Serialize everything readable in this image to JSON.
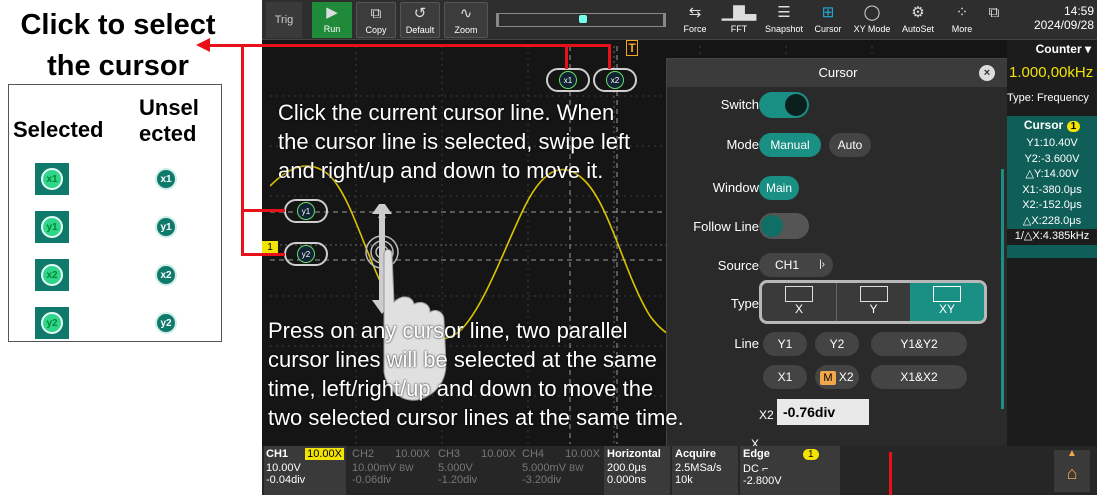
{
  "annotation": {
    "click_select_line1": "Click to select",
    "click_select_line2": "the cursor",
    "legend_selected": "Selected",
    "legend_unselected_1": "Unsel",
    "legend_unselected_2": "ected",
    "icons": [
      "x1",
      "y1",
      "x2",
      "y2"
    ],
    "hint_top": [
      "Click the current cursor line. When",
      "the cursor line is selected, swipe left",
      "and right/up and down to move it."
    ],
    "hint_bottom": [
      "Press on any cursor line, two parallel",
      "cursor lines will be selected at the same",
      "time, left/right/up and down to move the",
      "two selected cursor lines at the same time."
    ]
  },
  "toolbar": {
    "trig": "Trig",
    "buttons": [
      {
        "label": "Run",
        "icon": "play-icon"
      },
      {
        "label": "Copy",
        "icon": "copy-icon"
      },
      {
        "label": "Default",
        "icon": "reset-icon"
      },
      {
        "label": "Zoom",
        "icon": "zoom-wave-icon"
      },
      {
        "label": "Force",
        "icon": "force-trigger-icon"
      },
      {
        "label": "FFT",
        "icon": "fft-icon"
      },
      {
        "label": "Snapshot",
        "icon": "snapshot-icon"
      },
      {
        "label": "Cursor",
        "icon": "cursor-grid-icon"
      },
      {
        "label": "XY Mode",
        "icon": "xy-mode-icon"
      },
      {
        "label": "AutoSet",
        "icon": "autoset-icon"
      },
      {
        "label": "More",
        "icon": "more-grid-icon"
      }
    ],
    "time": "14:59",
    "date": "2024/09/28"
  },
  "waveform_tags": {
    "x1": "x1",
    "x2": "x2",
    "y1": "y1",
    "y2": "y2",
    "trigger_marker": "T",
    "ch_marker": "1"
  },
  "cursor_dialog": {
    "title": "Cursor",
    "switch_label": "Switch",
    "switch_on": true,
    "mode_label": "Mode",
    "mode_options": [
      "Manual",
      "Auto"
    ],
    "mode_selected": "Manual",
    "window_label": "Window",
    "window_value": "Main",
    "follow_label": "Follow Line",
    "follow_on": false,
    "source_label": "Source",
    "source_value": "CH1",
    "type_label": "Type",
    "type_options": [
      "X",
      "Y",
      "XY"
    ],
    "type_selected": "XY",
    "line_label": "Line",
    "line_row1": [
      "Y1",
      "Y2",
      "Y1&Y2"
    ],
    "line_row2_prefix": "M",
    "line_row2": [
      "X1",
      "X2",
      "X1&X2"
    ],
    "line_selected": "X2",
    "value_label": "X2",
    "value": "-0.76div",
    "next_row_partial": "X Unit"
  },
  "counter_panel": {
    "header": "Counter",
    "freq": "1.000,00kHz",
    "type": "Type: Frequency",
    "cursor_title": "Cursor",
    "cursor_badge": "1",
    "readings": [
      "Y1:10.40V",
      "Y2:-3.600V",
      "△Y:14.00V",
      "X1:-380.0μs",
      "X2:-152.0μs",
      "△X:228.0μs",
      "1/△X:4.385kHz"
    ]
  },
  "bottom_bar": {
    "ch1": {
      "name": "CH1",
      "scale": "10.00X",
      "v": "10.00V",
      "off": "-0.04div"
    },
    "ch2": {
      "name": "CH2",
      "scale": "10.00X",
      "v": "10.00mV",
      "off": "-0.06div",
      "bw": "BW"
    },
    "ch3": {
      "name": "CH3",
      "scale": "10.00X",
      "v": "5.000V",
      "off": "-1.20div"
    },
    "ch4": {
      "name": "CH4",
      "scale": "10.00X",
      "v": "5.000mV",
      "off": "-3.20div",
      "bw": "BW"
    },
    "horizontal": {
      "title": "Horizontal",
      "v1": "200.0μs",
      "v2": "0.000ns"
    },
    "acquire": {
      "title": "Acquire",
      "v1": "2.5MSa/s",
      "v2": "10k"
    },
    "edge": {
      "title": "Edge",
      "badge": "1",
      "v1": "DC",
      "v2": "-2.800V"
    },
    "home_icon": "home-icon"
  },
  "colors": {
    "accent": "#1a8f83",
    "ch1": "#f2e300",
    "red": "#e8111a",
    "sel_icon": "#2fd58a"
  }
}
